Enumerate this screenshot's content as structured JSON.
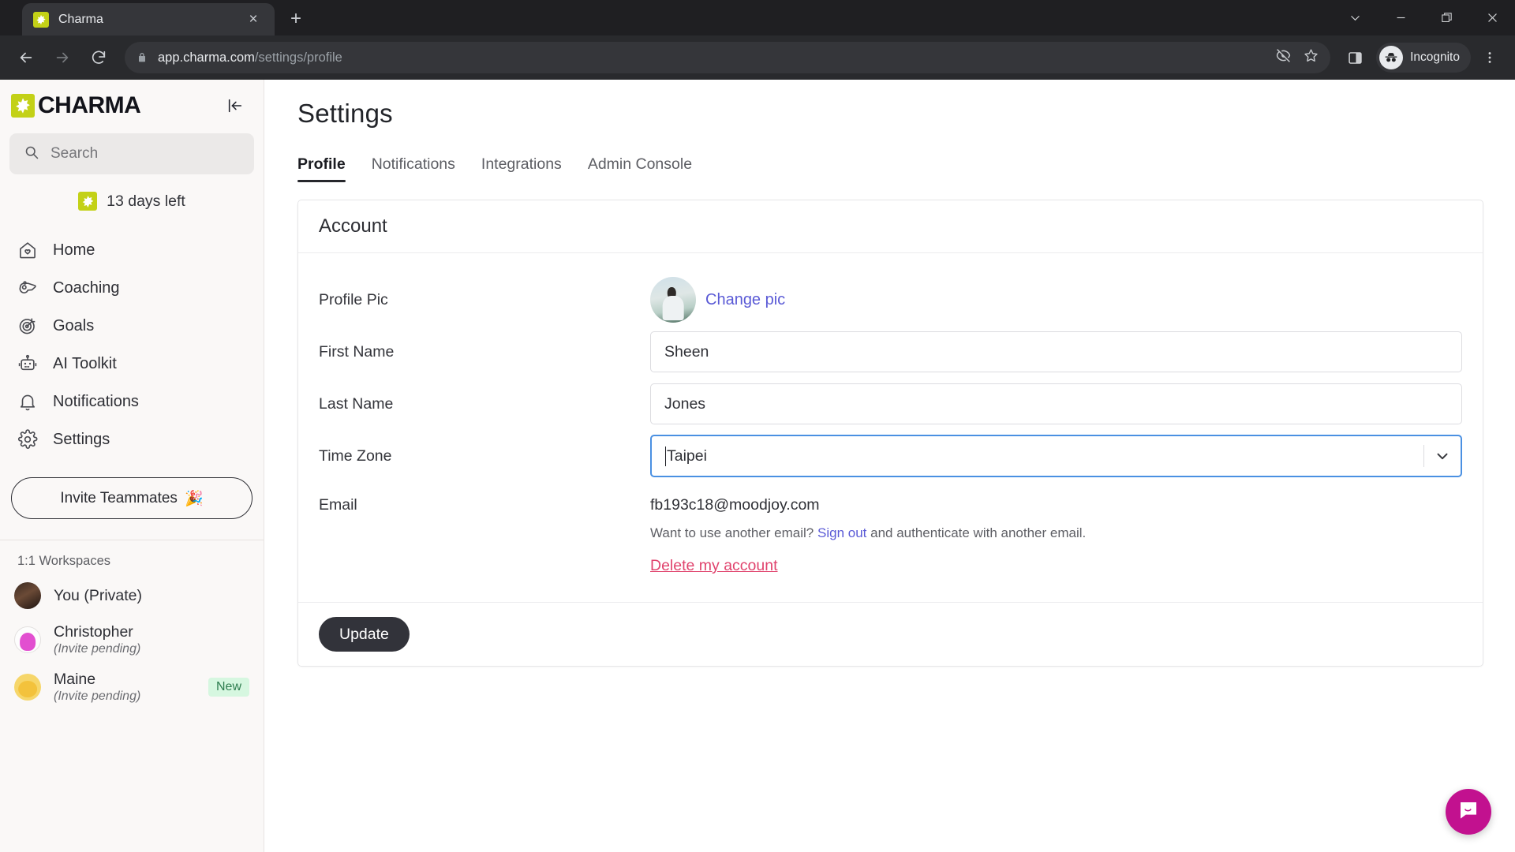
{
  "browser": {
    "tab": {
      "title": "Charma",
      "favicon": "charma-star-icon",
      "close": "×"
    },
    "new_tab_label": "+",
    "window_controls": {
      "minimize": "minimize-icon",
      "maximize": "maximize-icon",
      "close": "close-icon",
      "tab_search": "chevron-down-icon"
    },
    "url_secure_prefix": "app.charma.com",
    "url_path": "/settings/profile",
    "profile_label": "Incognito"
  },
  "sidebar": {
    "logo_text": "CHARMA",
    "collapse_tooltip": "collapse-sidebar",
    "search": {
      "placeholder": "Search",
      "value": ""
    },
    "trial": {
      "label": "13 days left"
    },
    "nav": [
      {
        "label": "Home",
        "icon": "home-heart-icon"
      },
      {
        "label": "Coaching",
        "icon": "whistle-icon"
      },
      {
        "label": "Goals",
        "icon": "target-icon"
      },
      {
        "label": "AI Toolkit",
        "icon": "robot-icon"
      },
      {
        "label": "Notifications",
        "icon": "bell-icon"
      },
      {
        "label": "Settings",
        "icon": "gear-icon"
      }
    ],
    "invite": {
      "label": "Invite Teammates",
      "emoji": "🎉"
    },
    "workspaces_heading": "1:1 Workspaces",
    "workspaces": [
      {
        "name": "You (Private)",
        "sub": "",
        "badge": ""
      },
      {
        "name": "Christopher",
        "sub": "(Invite pending)",
        "badge": ""
      },
      {
        "name": "Maine",
        "sub": "(Invite pending)",
        "badge": "New"
      }
    ]
  },
  "main": {
    "title": "Settings",
    "tabs": [
      {
        "label": "Profile",
        "active": true
      },
      {
        "label": "Notifications",
        "active": false
      },
      {
        "label": "Integrations",
        "active": false
      },
      {
        "label": "Admin Console",
        "active": false
      }
    ],
    "card": {
      "title": "Account",
      "rows": {
        "profile_pic": {
          "label": "Profile Pic",
          "action": "Change pic"
        },
        "first_name": {
          "label": "First Name",
          "value": "Sheen",
          "placeholder": "First Name"
        },
        "last_name": {
          "label": "Last Name",
          "value": "Jones",
          "placeholder": "Last Name"
        },
        "time_zone": {
          "label": "Time Zone",
          "value": "Taipei",
          "placeholder": "Time Zone",
          "focused": true
        },
        "email": {
          "label": "Email",
          "value": "fb193c18@moodjoy.com",
          "help_before": "Want to use another email? ",
          "help_link": "Sign out",
          "help_after": " and authenticate with another email.",
          "delete_label": "Delete my account"
        }
      },
      "submit_label": "Update"
    }
  },
  "support": {
    "label": "open-chat",
    "icon": "chat-bubble-icon"
  },
  "colors": {
    "brand_lime": "#c3d117",
    "focus_blue": "#4a90e2",
    "link_purple": "#5a5ad6",
    "danger_pink": "#e0436d",
    "badge_green_bg": "#d6f7e0",
    "badge_green_text": "#2e7d4f",
    "button_dark": "#32333a",
    "fab_magenta": "#c2118f"
  }
}
